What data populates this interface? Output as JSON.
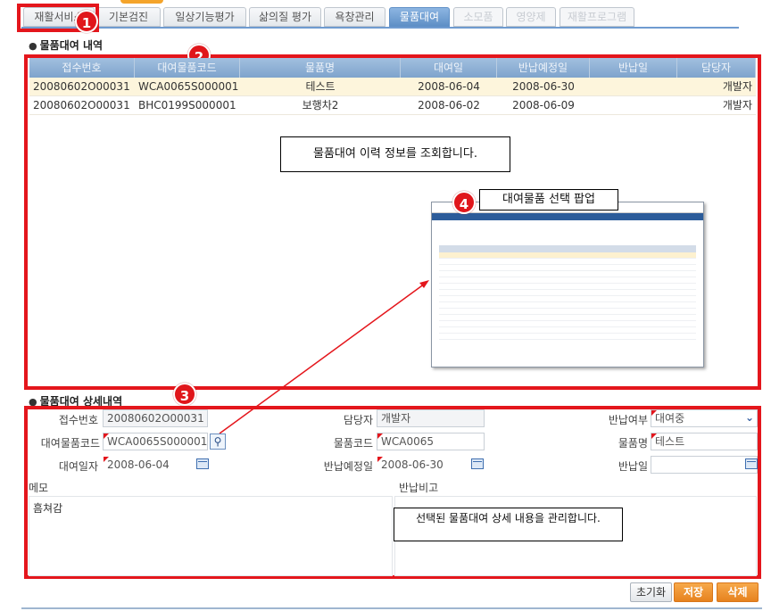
{
  "tabs": [
    {
      "label": "재활서비스",
      "state": "normal"
    },
    {
      "label": "기본검진",
      "state": "normal"
    },
    {
      "label": "일상기능평가",
      "state": "normal"
    },
    {
      "label": "삶의질 평가",
      "state": "normal"
    },
    {
      "label": "욕창관리",
      "state": "normal"
    },
    {
      "label": "물품대여",
      "state": "active"
    },
    {
      "label": "소모품",
      "state": "disabled"
    },
    {
      "label": "영양제",
      "state": "disabled"
    },
    {
      "label": "재활프로그램",
      "state": "disabled"
    }
  ],
  "badges": [
    "1",
    "2",
    "3",
    "4"
  ],
  "list_section": {
    "title": "물품대여 내역",
    "columns": [
      "접수번호",
      "대여물품코드",
      "물품명",
      "대여일",
      "반납예정일",
      "반납일",
      "담당자"
    ],
    "rows": [
      [
        "20080602O00031",
        "WCA0065S000001",
        "테스트",
        "2008-06-04",
        "2008-06-30",
        "",
        "개발자"
      ],
      [
        "20080602O00031",
        "BHC0199S000001",
        "보행차2",
        "2008-06-02",
        "2008-06-09",
        "",
        "개발자"
      ]
    ]
  },
  "callouts": {
    "list_desc": "물품대여 이력 정보를 조회합니다.",
    "popup_desc": "대여물품 선택 팝업",
    "detail_desc": "선택된 물품대여 상세 내용을 관리합니다."
  },
  "detail_section": {
    "title": "물품대여 상세내역",
    "receipt_no": {
      "label": "접수번호",
      "value": "20080602O00031"
    },
    "manager": {
      "label": "담당자",
      "value": "개발자"
    },
    "return_status": {
      "label": "반납여부",
      "value": "대여중"
    },
    "rental_item_code": {
      "label": "대여물품코드",
      "value": "WCA0065S000001"
    },
    "item_code": {
      "label": "물품코드",
      "value": "WCA0065"
    },
    "item_name": {
      "label": "물품명",
      "value": "테스트"
    },
    "rental_date": {
      "label": "대여일자",
      "value": "2008-06-04"
    },
    "planned_return": {
      "label": "반납예정일",
      "value": "2008-06-30"
    },
    "return_date": {
      "label": "반납일",
      "value": ""
    },
    "memo": {
      "label": "메모",
      "value": "흠쳐감"
    },
    "return_note": {
      "label": "반납비고",
      "value": ""
    }
  },
  "buttons": {
    "reset": "초기화",
    "save": "저장",
    "delete": "삭제"
  },
  "colors": {
    "highlight": "#e4161c",
    "tab_active": "#6a98cc",
    "button_orange": "#e6821f",
    "selected_row": "#fdf5dc"
  }
}
